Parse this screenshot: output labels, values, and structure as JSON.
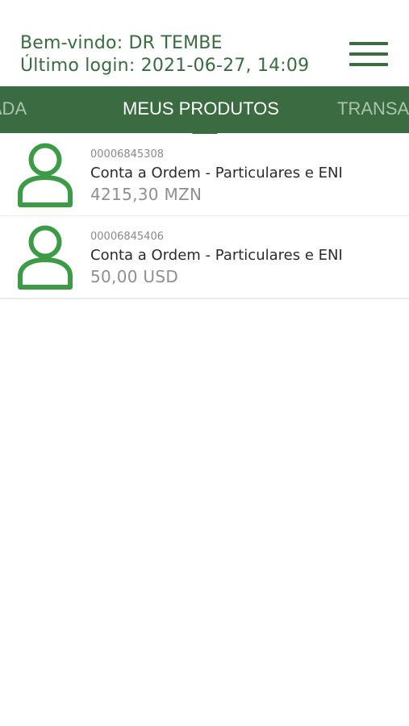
{
  "header": {
    "welcome_line": "Bem-vindo: DR TEMBE",
    "last_login_line": "Último login: 2021-06-27, 14:09",
    "menu_icon": "hamburger-menu-icon"
  },
  "tabs": [
    {
      "label": "RADA",
      "active": false
    },
    {
      "label": "MEUS PRODUTOS",
      "active": true
    },
    {
      "label": "TRANSA",
      "active": false
    }
  ],
  "products": [
    {
      "account_number": "00006845308",
      "name": "Conta a Ordem - Particulares e ENI",
      "balance": "4215,30 MZN",
      "icon": "user-avatar-icon"
    },
    {
      "account_number": "00006845406",
      "name": "Conta a Ordem - Particulares e ENI",
      "balance": "50,00 USD",
      "icon": "user-avatar-icon"
    }
  ],
  "colors": {
    "brand_green": "#3a6b41",
    "icon_green": "#3d9a46",
    "inactive_tab": "#a9c4ab"
  }
}
